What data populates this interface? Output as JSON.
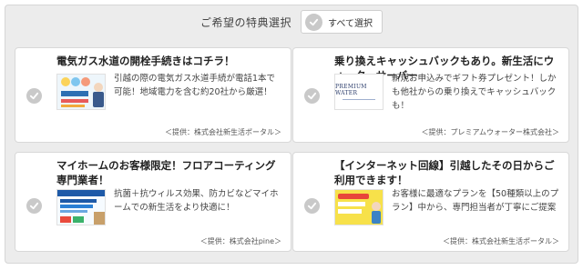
{
  "header": {
    "title": "ご希望の特典選択",
    "select_all_label": "すべて選択"
  },
  "cards": [
    {
      "title": "電気ガス水道の開栓手続きはコチラ！",
      "description": "引越の際の電気ガス水道手続が電話1本で可能！地域電力を含む約20社から厳選！",
      "source": "＜提供：株式会社新生活ポータル＞",
      "thumb_icon": "utility-illustration"
    },
    {
      "title": "乗り換えキャッシュバックもあり。新生活にウォーターサーバー",
      "description": "新規お申込みでギフト券プレゼント！しかも他社からの乗り換えでキャッシュバックも！",
      "source": "＜提供：プレミアムウォーター株式会社＞",
      "thumb_brand": "PREMIUM WATER"
    },
    {
      "title": "マイホームのお客様限定！フロアコーティング専門業者！",
      "description": "抗菌＋抗ウィルス効果、防カビなどマイホームでの新生活をより快適に！",
      "source": "＜提供：株式会社pine＞",
      "thumb_icon": "floor-coating-banner"
    },
    {
      "title": "【インターネット回線】引越したその日からご利用できます！",
      "description": "お客様に最適なプランを【50種類以上のプラン】中から、専門担当者が丁寧にご提案",
      "source": "＜提供：株式会社新生活ポータル＞",
      "thumb_icon": "internet-banner"
    }
  ],
  "colors": {
    "panel_bg": "#ececec",
    "check_gray": "#c9c9c9",
    "accent_yellow": "#f7e14a"
  }
}
